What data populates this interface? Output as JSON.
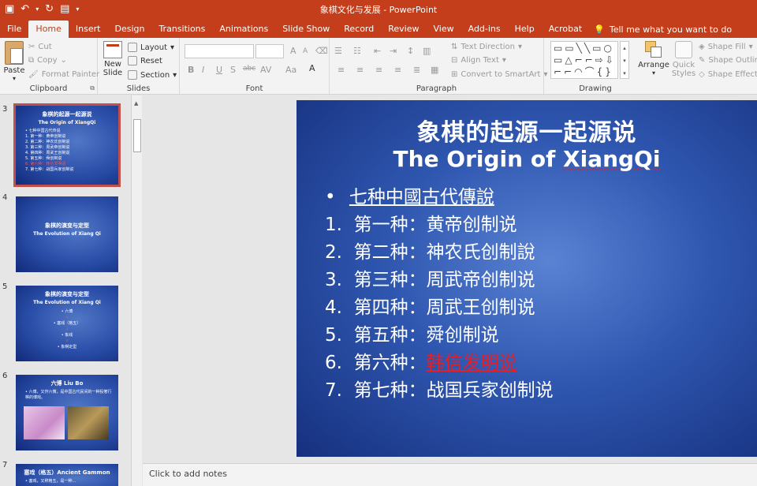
{
  "window": {
    "title": "象棋文化与发展  -  PowerPoint"
  },
  "tabs": {
    "file": "File",
    "home": "Home",
    "insert": "Insert",
    "design": "Design",
    "transitions": "Transitions",
    "animations": "Animations",
    "slideshow": "Slide Show",
    "record": "Record",
    "review": "Review",
    "view": "View",
    "addins": "Add-ins",
    "help": "Help",
    "acrobat": "Acrobat",
    "tellme": "Tell me what you want to do"
  },
  "ribbon": {
    "clipboard": {
      "label": "Clipboard",
      "paste": "Paste",
      "cut": "Cut",
      "copy": "Copy",
      "format_painter": "Format Painter"
    },
    "slides": {
      "label": "Slides",
      "new_slide_1": "New",
      "new_slide_2": "Slide",
      "layout": "Layout",
      "reset": "Reset",
      "section": "Section"
    },
    "font": {
      "label": "Font",
      "bold": "B",
      "italic": "I",
      "underline": "U",
      "shadow": "S",
      "strike": "abc",
      "aa": "Aa",
      "grow": "A",
      "shrink": "A"
    },
    "paragraph": {
      "label": "Paragraph",
      "text_direction": "Text Direction",
      "align_text": "Align Text",
      "smartart": "Convert to SmartArt"
    },
    "drawing": {
      "label": "Drawing",
      "arrange": "Arrange",
      "quick_styles_1": "Quick",
      "quick_styles_2": "Styles",
      "shape_fill": "Shape Fill",
      "shape_outline": "Shape Outline",
      "shape_effects": "Shape Effects"
    }
  },
  "thumbnails": {
    "items": [
      {
        "number": "3",
        "title": "象棋的起源一起源说",
        "subtitle": "The Origin of XiangQi",
        "lines": [
          "• 七种中国古代传说",
          "1. 第一种：黄帝创制说",
          "2. 第二种：神农氏创制说",
          "3. 第三种：周武帝创制说",
          "4. 第四种：周武王创制说",
          "5. 第五种：舜创制说",
          "6. 第六种：韩信发明说",
          "7. 第七种：战国兵家创制说"
        ]
      },
      {
        "number": "4",
        "title": "象棋的演变与定型",
        "subtitle": "The Evolution of Xiang Qi"
      },
      {
        "number": "5",
        "title": "象棋的演变与定型",
        "subtitle": "The Evolution of Xiang Qi",
        "lines": [
          "• 六博",
          "• 塞戏（格五）",
          "• 象戏",
          "• 象棋定型"
        ]
      },
      {
        "number": "6",
        "title": "六博 Liu Bo",
        "lines": [
          "• 六博，又作六簙，是中国古代民间的一种投箸行棋的博戏。"
        ]
      },
      {
        "number": "7",
        "title": "塞戏（格五）Ancient Gammon",
        "lines": [
          "• 塞戏，又称格五，是一种..."
        ]
      }
    ]
  },
  "slide": {
    "title": "象棋的起源一起源说",
    "subtitle_pre": "The Origin of ",
    "subtitle_word": "XiangQi",
    "bullet_mark": "•",
    "bullet": "七种中國古代傳說",
    "items": [
      {
        "num": "1.",
        "pre": "第一种：",
        "text": "黄帝创制说"
      },
      {
        "num": "2.",
        "pre": "第二种：",
        "text": "神农氏创制說"
      },
      {
        "num": "3.",
        "pre": "第三种：",
        "text": "周武帝创制说"
      },
      {
        "num": "4.",
        "pre": "第四种：",
        "text": "周武王创制说"
      },
      {
        "num": "5.",
        "pre": "第五种：",
        "text": "舜创制说"
      },
      {
        "num": "6.",
        "pre": "第六种：",
        "text": "韩信发明说"
      },
      {
        "num": "7.",
        "pre": "第七种：",
        "text": "战国兵家创制说"
      }
    ],
    "highlight_color": "#e0202a"
  },
  "notes": {
    "placeholder": "Click to add notes"
  },
  "colors": {
    "accent": "#c43e1c",
    "slide_blue": "#2f57b0"
  }
}
